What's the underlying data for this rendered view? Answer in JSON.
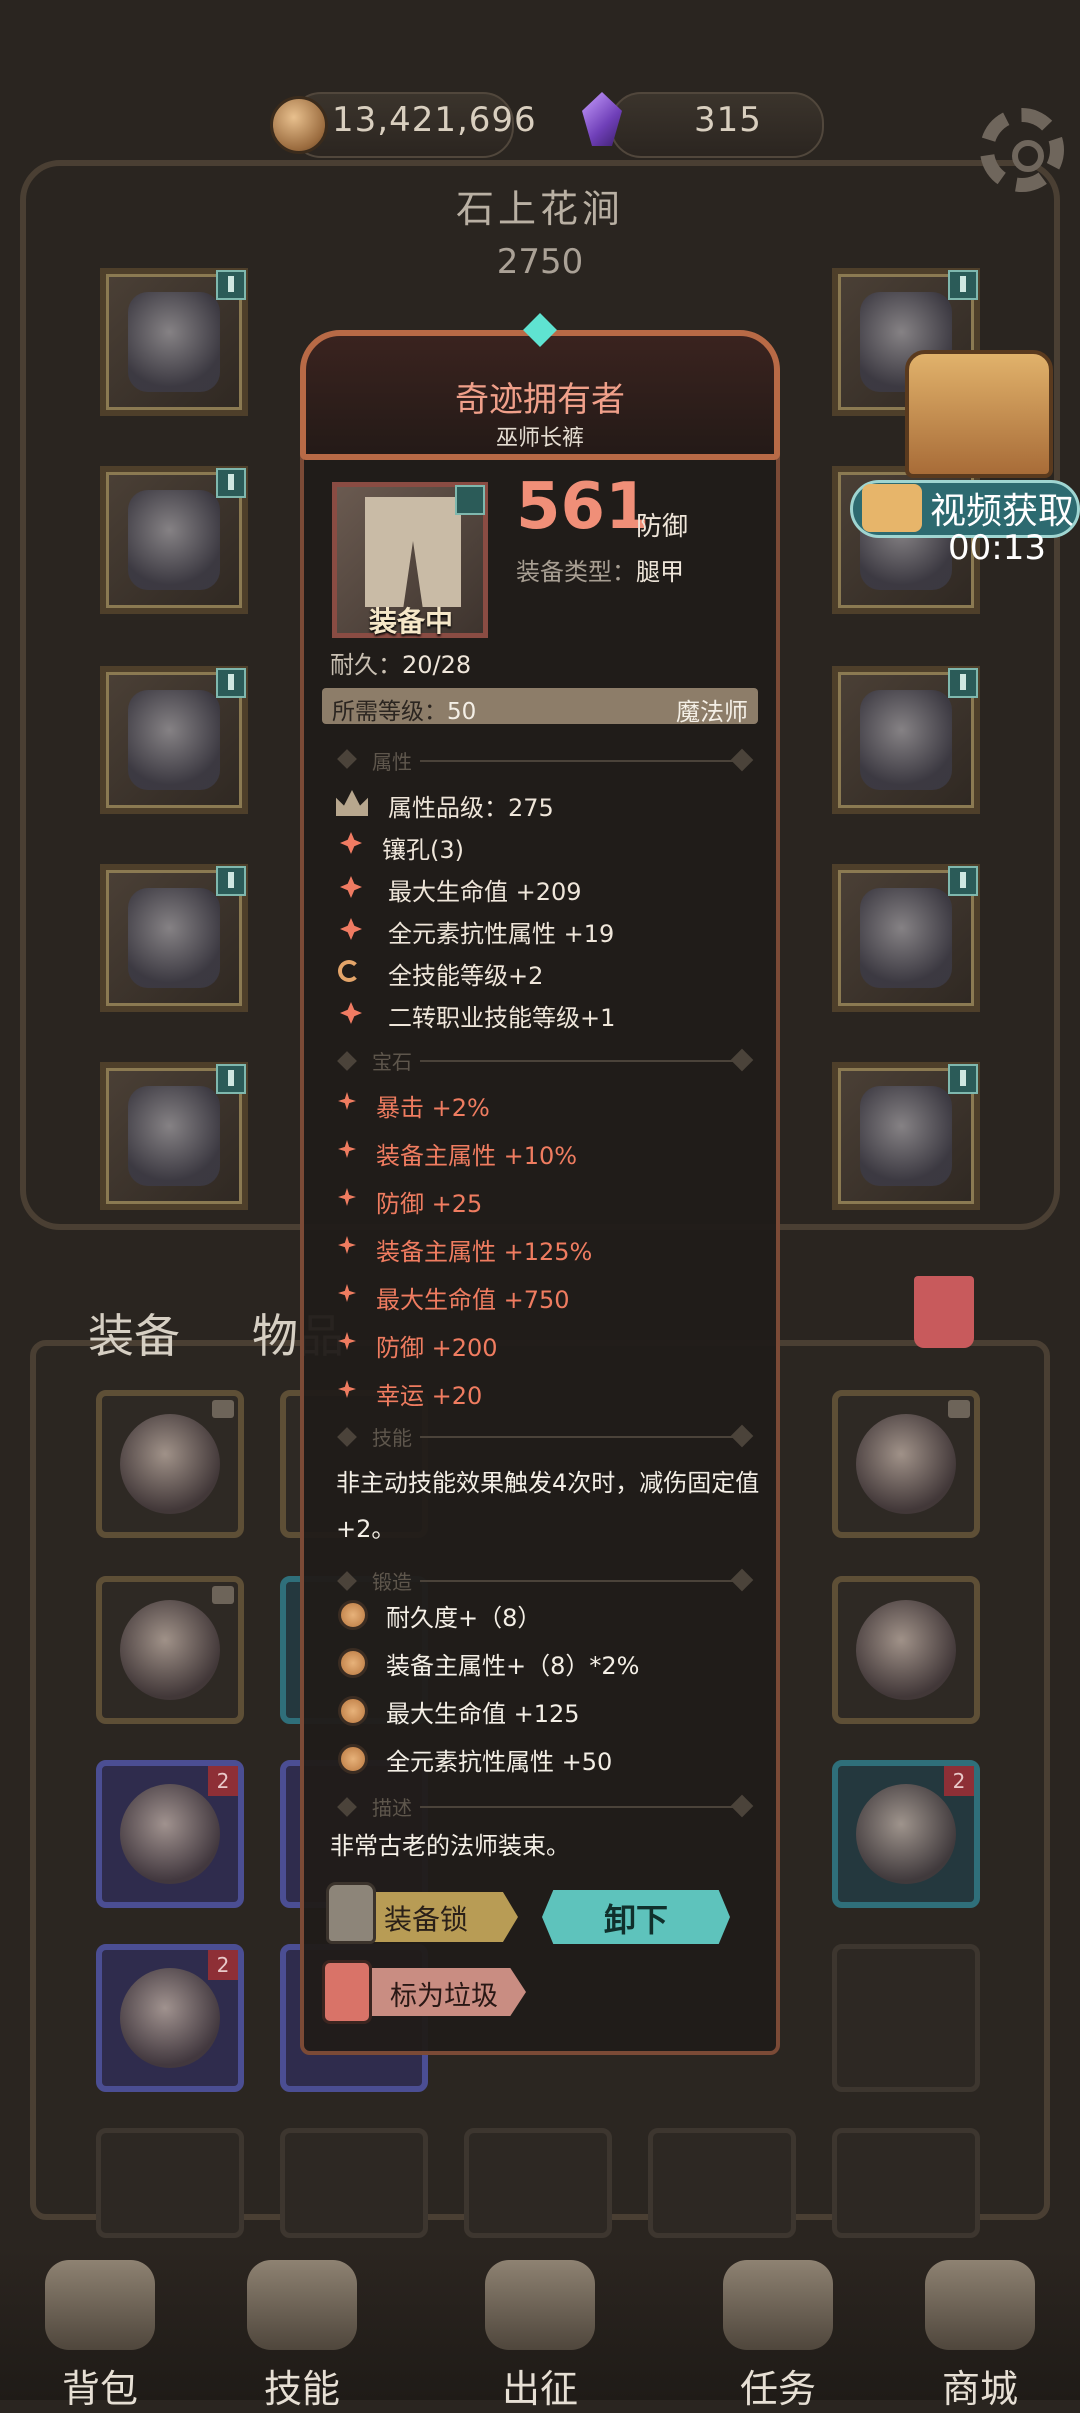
{
  "resources": {
    "gold": "13,421,696",
    "gems": "315"
  },
  "location": {
    "name": "石上花涧",
    "power": "2750"
  },
  "video_reward": {
    "label": "视频获取",
    "timer": "00:13"
  },
  "tabs": {
    "equipment": "装备",
    "items": "物品"
  },
  "nav": [
    {
      "label": "背包"
    },
    {
      "label": "技能"
    },
    {
      "label": "出征"
    },
    {
      "label": "任务"
    },
    {
      "label": "商城"
    }
  ],
  "item": {
    "name": "奇迹拥有者",
    "subtitle": "巫师长裤",
    "equipped_label": "装备中",
    "defense_value": "561",
    "defense_label": "防御",
    "type_label": "装备类型：",
    "type_value": "腿甲",
    "durability_label": "耐久：",
    "durability_value": "20/28",
    "required_level_label": "所需等级：",
    "required_level_value": "50",
    "required_class": "魔法师",
    "sections": {
      "attributes": "属性",
      "gems": "宝石",
      "skills": "技能",
      "forging": "锻造",
      "description": "描述"
    },
    "attributes": [
      "属性品级：275",
      "镶孔(3)",
      "最大生命值 +209",
      "全元素抗性属性 +19",
      "全技能等级+2",
      "二转职业技能等级+1"
    ],
    "gems": [
      "暴击 +2%",
      "装备主属性 +10%",
      "防御 +25",
      "装备主属性 +125%",
      "最大生命值 +750",
      "防御 +200",
      "幸运 +20"
    ],
    "skill_text": "非主动技能效果触发4次时，减伤固定值+2。",
    "forging": [
      "耐久度+（8）",
      "装备主属性+（8）*2%",
      "最大生命值 +125",
      "全元素抗性属性 +50"
    ],
    "description": "非常古老的法师装束。",
    "buttons": {
      "lock": "装备锁",
      "unequip": "卸下",
      "mark_junk": "标为垃圾"
    }
  },
  "colors": {
    "accent": "#f08f78",
    "gem_text": "#ef7c60",
    "teal_button": "#5ec3bc",
    "panel_border": "#b86a46"
  }
}
